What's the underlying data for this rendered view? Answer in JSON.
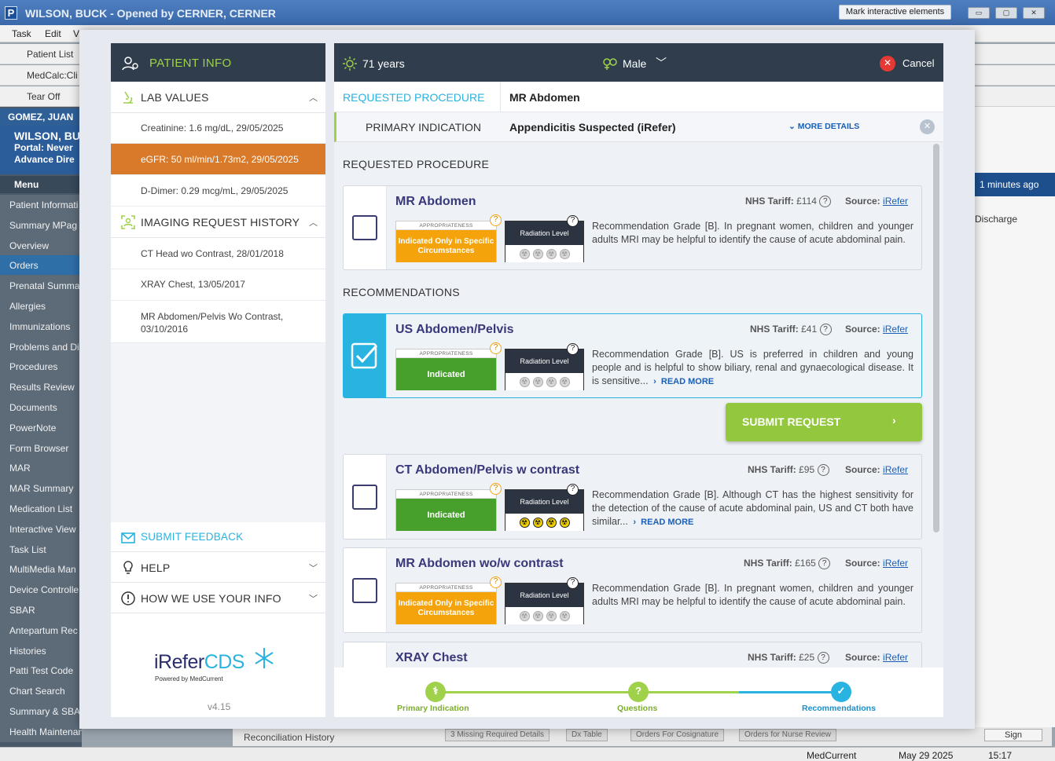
{
  "window": {
    "title": "WILSON, BUCK - Opened by CERNER, CERNER",
    "mark_button": "Mark interactive elements",
    "win_min": "▭",
    "win_max": "▢",
    "win_close": "✕"
  },
  "menubar": {
    "items": [
      "Task",
      "Edit",
      "V"
    ]
  },
  "toolbars": {
    "patient_list": "Patient List",
    "medcalc": "MedCalc:Cli",
    "tear_off": "Tear Off"
  },
  "ehr": {
    "patient_header": "GOMEZ, JUAN",
    "banner_name": "WILSON, BU",
    "banner_portal": "Portal: Never",
    "banner_advance": "Advance Dire",
    "menu_label": "Menu",
    "menu_items": [
      "Patient Informati",
      "Summary MPag",
      "Overview",
      "Orders",
      "Prenatal Summa",
      "Allergies",
      "Immunizations",
      "Problems and Di",
      "Procedures",
      "Results Review",
      "Documents",
      "PowerNote",
      "Form Browser",
      "MAR",
      "MAR Summary",
      "Medication List",
      "Interactive View",
      "Task List",
      "MultiMedia Man",
      "Device Controlle",
      "SBAR",
      "Antepartum Rec",
      "Histories",
      "Patti Test Code",
      "Chart Search",
      "Summary & SBA",
      "Health Maintenance"
    ],
    "right_time": "1 minutes ago",
    "right_discharge": "Discharge",
    "bottom_tabs": [
      "Reconciliation History",
      "3 Missing Required Details",
      "Dx Table",
      "Orders For Cosignature",
      "Orders for Nurse Review"
    ],
    "sign_button": "Sign",
    "status": {
      "app": "MedCurrent",
      "date": "May 29 2025",
      "time": "15:17"
    }
  },
  "patient_info": {
    "title": "PATIENT INFO",
    "lab_values_title": "LAB VALUES",
    "lab_values": [
      "Creatinine: 1.6 mg/dL, 29/05/2025",
      "eGFR: 50 ml/min/1.73m2, 29/05/2025",
      "D-Dimer: 0.29 mcg/mL, 29/05/2025"
    ],
    "history_title": "IMAGING REQUEST HISTORY",
    "history": [
      "CT Head wo Contrast, 28/01/2018",
      "XRAY Chest, 13/05/2017",
      "MR Abdomen/Pelvis Wo Contrast, 03/10/2016"
    ],
    "submit_feedback": "SUBMIT FEEDBACK",
    "help": "HELP",
    "how_we_use": "HOW WE USE YOUR INFO",
    "logo_irefer": "iRefer",
    "logo_cds": "CDS",
    "logo_powered": "Powered by MedCurrent",
    "version": "v4.15"
  },
  "header": {
    "age": "71 years",
    "sex": "Male",
    "cancel": "Cancel"
  },
  "requested": {
    "label": "REQUESTED PROCEDURE",
    "value": "MR Abdomen",
    "indication_label": "PRIMARY INDICATION",
    "indication_value": "Appendicitis Suspected (iRefer)",
    "more_details": "MORE DETAILS"
  },
  "sections": {
    "requested_title": "REQUESTED PROCEDURE",
    "recommendations_title": "RECOMMENDATIONS"
  },
  "labels": {
    "appropriateness": "APPROPRIATENESS",
    "radiation": "Radiation Level",
    "tariff": "NHS Tariff:",
    "source": "Source:",
    "read_more": "READ MORE",
    "q": "?"
  },
  "cards": [
    {
      "name": "MR Abdomen",
      "tariff": "£114",
      "source": "iRefer",
      "appropriateness": "Indicated Only in Specific Circumstances",
      "appr_color": "#f5a30b",
      "radiation_level": 0,
      "selected": false,
      "desc": "Recommendation Grade [B]. In pregnant women, children and younger adults MRI may be helpful to identify the cause of acute abdominal pain."
    },
    {
      "name": "US Abdomen/Pelvis",
      "tariff": "£41",
      "source": "iRefer",
      "appropriateness": "Indicated",
      "appr_color": "#47a02b",
      "radiation_level": 0,
      "selected": true,
      "desc": "Recommendation Grade [B]. US is preferred in children and young people and is helpful to show biliary, renal and gynaecological disease. It is sensitive..."
    },
    {
      "name": "CT Abdomen/Pelvis w contrast",
      "tariff": "£95",
      "source": "iRefer",
      "appropriateness": "Indicated",
      "appr_color": "#47a02b",
      "radiation_level": 4,
      "selected": false,
      "desc": "Recommendation Grade [B]. Although CT has the highest sensitivity for the detection of the cause of acute abdominal pain, US and CT both have similar..."
    },
    {
      "name": "MR Abdomen wo/w contrast",
      "tariff": "£165",
      "source": "iRefer",
      "appropriateness": "Indicated Only in Specific Circumstances",
      "appr_color": "#f5a30b",
      "radiation_level": 0,
      "selected": false,
      "desc": "Recommendation Grade [B]. In pregnant women, children and younger adults MRI may be helpful to identify the cause of acute abdominal pain."
    },
    {
      "name": "XRAY Chest",
      "tariff": "£25",
      "source": "iRefer"
    }
  ],
  "submit_request": "SUBMIT REQUEST",
  "stepper": {
    "steps": [
      "Primary Indication",
      "Questions",
      "Recommendations"
    ]
  },
  "colors": {
    "navy": "#2f3d4d",
    "green": "#9fd14a",
    "accent_blue": "#29b3e0",
    "orange": "#d87a2a"
  }
}
